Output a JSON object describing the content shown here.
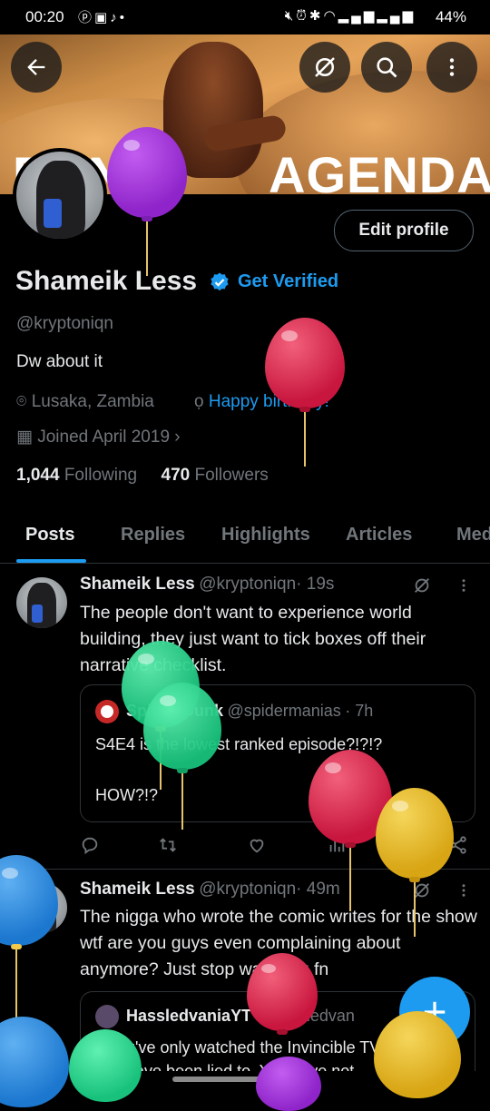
{
  "status_bar": {
    "time": "00:20",
    "left_icons": [
      "pinterest-icon",
      "gallery-icon",
      "tiktok-icon",
      "dot-icon"
    ],
    "right_icons": [
      "mute-icon",
      "alarm-icon",
      "bluetooth-icon",
      "wifi-icon",
      "signal-icon",
      "signal-icon"
    ],
    "battery": "44%"
  },
  "banner": {
    "text_left": "DUNE",
    "text_right": "AGENDA"
  },
  "top_actions": {
    "back": "back-arrow-icon",
    "mute": "no-translate-icon",
    "search": "search-icon",
    "more": "more-vertical-icon"
  },
  "profile": {
    "edit_label": "Edit profile",
    "name": "Shameik Less",
    "get_verified": "Get Verified",
    "handle": "@kryptoniqn",
    "bio": "Dw about it",
    "location": "Lusaka, Zambia",
    "birthday": "Happy birthday!",
    "joined": "Joined April 2019",
    "following_count": "1,044",
    "following_label": "Following",
    "followers_count": "470",
    "followers_label": "Followers"
  },
  "tabs": [
    "Posts",
    "Replies",
    "Highlights",
    "Articles",
    "Media"
  ],
  "posts": [
    {
      "name": "Shameik Less",
      "handle": "@kryptoniqn",
      "time": "· 19s",
      "text": "The people don't want to experience world building, they just want to tick boxes off their narrative checklist.",
      "quote": {
        "name": "Spider-Dunk",
        "handle": "@spidermanias",
        "time": "· 7h",
        "text1": "S4E4 is the lowest ranked episode?!?!?",
        "text2": "HOW?!?"
      }
    },
    {
      "name": "Shameik Less",
      "handle": "@kryptoniqn",
      "time": "· 49m",
      "text": "The nigga who wrote the comic writes for the show wtf are you guys even complaining about anymore? Just stop watching fn",
      "quote": {
        "name": "HassledvaniaYT",
        "handle": "@hassledvan",
        "text1": "If you've only watched the Invincible TV",
        "text2": "you have been lied to. You have not"
      }
    }
  ],
  "colors": {
    "accent": "#1d9bf0",
    "background": "#000000",
    "text": "#e7e9ea",
    "muted": "#71767b"
  }
}
